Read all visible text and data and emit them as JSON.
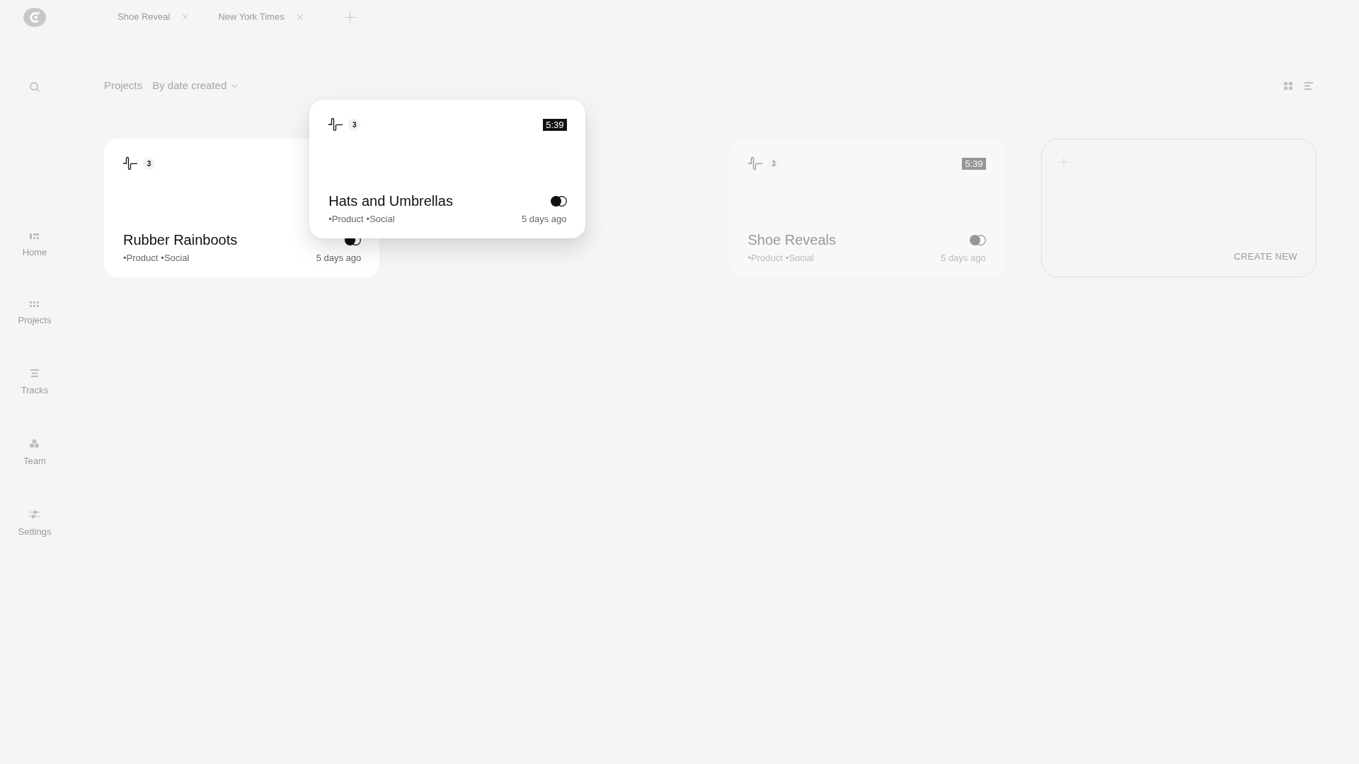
{
  "top_bar": {
    "tabs": [
      {
        "label": "Shoe Reveal",
        "selected": false
      },
      {
        "label": "New York Times",
        "selected": false
      }
    ]
  },
  "sidebar": {
    "items": [
      {
        "label": "Home",
        "selected": false
      },
      {
        "label": "Projects",
        "selected": false
      },
      {
        "label": "Tracks",
        "selected": false
      },
      {
        "label": "Team",
        "selected": false
      },
      {
        "label": "Settings",
        "selected": false
      }
    ]
  },
  "toolbar": {
    "title": "Projects",
    "sort": "By date created"
  },
  "projects": [
    {
      "kind": "project",
      "title": "Rubber Rainboots",
      "count": "3",
      "tags": [
        "•Product",
        "•Social"
      ],
      "updated": "5 days ago",
      "dragging": false,
      "dimmed": false
    },
    {
      "kind": "project",
      "title": "Hats and Umbrellas",
      "count": "3",
      "duration": "5:39",
      "tags": [
        "•Product",
        "•Social"
      ],
      "updated": "5 days ago",
      "dragging": true,
      "dimmed": false
    },
    {
      "kind": "project",
      "title": "Shoe Reveals",
      "count": "3",
      "duration": "5:39",
      "tags": [
        "•Product",
        "•Social"
      ],
      "updated": "5 days ago",
      "dragging": false,
      "dimmed": true
    },
    {
      "kind": "create",
      "label": "CREATE NEW"
    }
  ]
}
